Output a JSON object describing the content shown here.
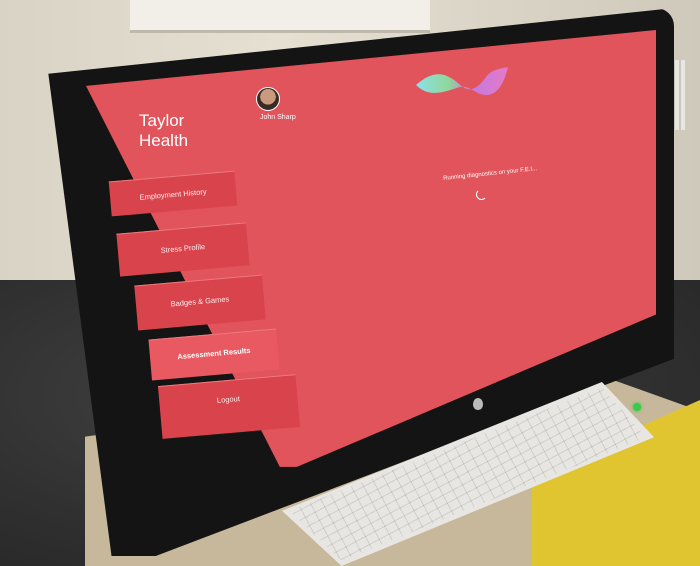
{
  "app": {
    "brand": "Taylor Health",
    "brand_line1": "Taylor",
    "brand_line2": "Health"
  },
  "sidebar": {
    "items": [
      {
        "label": "Employment History",
        "active": false
      },
      {
        "label": "Stress Profile",
        "active": false
      },
      {
        "label": "Badges & Games",
        "active": false
      },
      {
        "label": "Assessment Results",
        "active": true
      },
      {
        "label": "Logout",
        "active": false
      }
    ]
  },
  "user": {
    "name": "John Sharp"
  },
  "status": {
    "text": "Running diagnostics on your F.E.I..."
  },
  "colors": {
    "screen_bg": "#e1545c",
    "active_item": "#e95962",
    "text": "#ffffff"
  }
}
